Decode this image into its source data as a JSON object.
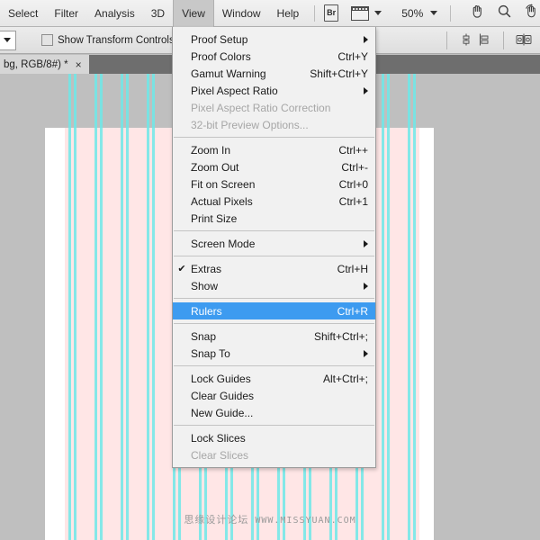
{
  "menubar": {
    "items": [
      {
        "label": "Select",
        "active": false
      },
      {
        "label": "Filter",
        "active": false
      },
      {
        "label": "Analysis",
        "active": false
      },
      {
        "label": "3D",
        "active": false
      },
      {
        "label": "View",
        "active": true
      },
      {
        "label": "Window",
        "active": false
      },
      {
        "label": "Help",
        "active": false
      }
    ],
    "bridge_label": "Br",
    "zoom_level": "50%",
    "tool_icons": [
      "hand-icon",
      "zoom-icon",
      "rotate-view-icon"
    ]
  },
  "options_bar": {
    "show_transform_controls": "Show Transform Controls",
    "checkbox_checked": false
  },
  "tabbar": {
    "document_title": "bg, RGB/8#) *",
    "close_label": "×"
  },
  "view_menu": {
    "groups": [
      {
        "items": [
          {
            "label": "Proof Setup",
            "accel": "",
            "submenu": true,
            "disabled": false,
            "checked": false,
            "highlight": false
          },
          {
            "label": "Proof Colors",
            "accel": "Ctrl+Y",
            "submenu": false,
            "disabled": false,
            "checked": false,
            "highlight": false
          },
          {
            "label": "Gamut Warning",
            "accel": "Shift+Ctrl+Y",
            "submenu": false,
            "disabled": false,
            "checked": false,
            "highlight": false
          },
          {
            "label": "Pixel Aspect Ratio",
            "accel": "",
            "submenu": true,
            "disabled": false,
            "checked": false,
            "highlight": false
          },
          {
            "label": "Pixel Aspect Ratio Correction",
            "accel": "",
            "submenu": false,
            "disabled": true,
            "checked": false,
            "highlight": false
          },
          {
            "label": "32-bit Preview Options...",
            "accel": "",
            "submenu": false,
            "disabled": true,
            "checked": false,
            "highlight": false
          }
        ]
      },
      {
        "items": [
          {
            "label": "Zoom In",
            "accel": "Ctrl++",
            "submenu": false,
            "disabled": false,
            "checked": false,
            "highlight": false
          },
          {
            "label": "Zoom Out",
            "accel": "Ctrl+-",
            "submenu": false,
            "disabled": false,
            "checked": false,
            "highlight": false
          },
          {
            "label": "Fit on Screen",
            "accel": "Ctrl+0",
            "submenu": false,
            "disabled": false,
            "checked": false,
            "highlight": false
          },
          {
            "label": "Actual Pixels",
            "accel": "Ctrl+1",
            "submenu": false,
            "disabled": false,
            "checked": false,
            "highlight": false
          },
          {
            "label": "Print Size",
            "accel": "",
            "submenu": false,
            "disabled": false,
            "checked": false,
            "highlight": false
          }
        ]
      },
      {
        "items": [
          {
            "label": "Screen Mode",
            "accel": "",
            "submenu": true,
            "disabled": false,
            "checked": false,
            "highlight": false
          }
        ]
      },
      {
        "items": [
          {
            "label": "Extras",
            "accel": "Ctrl+H",
            "submenu": false,
            "disabled": false,
            "checked": true,
            "highlight": false
          },
          {
            "label": "Show",
            "accel": "",
            "submenu": true,
            "disabled": false,
            "checked": false,
            "highlight": false
          }
        ]
      },
      {
        "items": [
          {
            "label": "Rulers",
            "accel": "Ctrl+R",
            "submenu": false,
            "disabled": false,
            "checked": false,
            "highlight": true
          }
        ]
      },
      {
        "items": [
          {
            "label": "Snap",
            "accel": "Shift+Ctrl+;",
            "submenu": false,
            "disabled": false,
            "checked": false,
            "highlight": false
          },
          {
            "label": "Snap To",
            "accel": "",
            "submenu": true,
            "disabled": false,
            "checked": false,
            "highlight": false
          }
        ]
      },
      {
        "items": [
          {
            "label": "Lock Guides",
            "accel": "Alt+Ctrl+;",
            "submenu": false,
            "disabled": false,
            "checked": false,
            "highlight": false
          },
          {
            "label": "Clear Guides",
            "accel": "",
            "submenu": false,
            "disabled": false,
            "checked": false,
            "highlight": false
          },
          {
            "label": "New Guide...",
            "accel": "",
            "submenu": false,
            "disabled": false,
            "checked": false,
            "highlight": false
          }
        ]
      },
      {
        "items": [
          {
            "label": "Lock Slices",
            "accel": "",
            "submenu": false,
            "disabled": false,
            "checked": false,
            "highlight": false
          },
          {
            "label": "Clear Slices",
            "accel": "",
            "submenu": false,
            "disabled": true,
            "checked": false,
            "highlight": false
          }
        ]
      }
    ]
  },
  "watermark": {
    "cn_text": "思缘设计论坛",
    "url_text": "WWW.MISSYUAN.COM"
  },
  "colors": {
    "menu_highlight": "#3d9bf0",
    "canvas_pink": "#ffe6e6",
    "stripe_cyan": "#6ee8e8",
    "workspace_gray": "#bfbfbf",
    "tabbar_gray": "#6e6e6e"
  }
}
